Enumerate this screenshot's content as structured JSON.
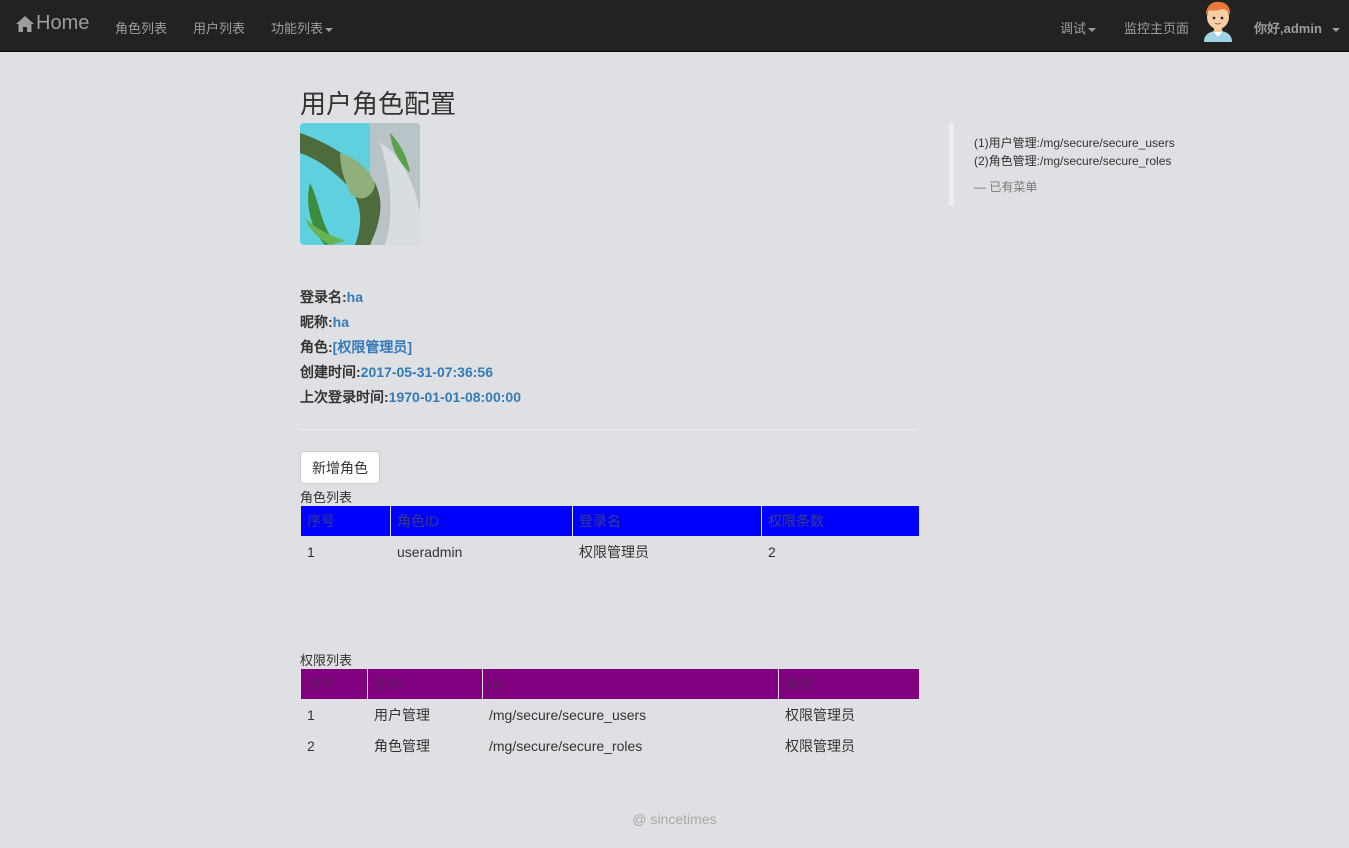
{
  "navbar": {
    "brand": "Home",
    "items": [
      {
        "label": "角色列表"
      },
      {
        "label": "用户列表"
      },
      {
        "label": "功能列表"
      }
    ],
    "right_items": [
      {
        "label": "调试"
      },
      {
        "label": "监控主页面"
      }
    ],
    "user_greeting": "你好,admin"
  },
  "page": {
    "title": "用户角色配置",
    "info": {
      "login_label": "登录名:",
      "login_value": "ha",
      "nickname_label": "昵称:",
      "nickname_value": "ha",
      "role_label": "角色:",
      "role_value": "[权限管理员]",
      "created_label": "创建时间:",
      "created_value": "2017-05-31-07:36:56",
      "lastlogin_label": "上次登录时间:",
      "lastlogin_value": "1970-01-01-08:00:00"
    },
    "add_role_button": "新增角色",
    "roles_caption": "角色列表",
    "roles_table": {
      "headers": [
        "序号",
        "角色ID",
        "登录名",
        "权限条数"
      ],
      "rows": [
        [
          "1",
          "useradmin",
          "权限管理员",
          "2"
        ]
      ]
    },
    "perms_caption": "权限列表",
    "perms_table": {
      "headers": [
        "序号",
        "名称",
        "url",
        "角色"
      ],
      "rows": [
        [
          "1",
          "用户管理",
          "/mg/secure/secure_users",
          "权限管理员"
        ],
        [
          "2",
          "角色管理",
          "/mg/secure/secure_roles",
          "权限管理员"
        ]
      ]
    }
  },
  "sidebar_quote": {
    "lines": [
      "(1)用户管理:/mg/secure/secure_users",
      "(2)角色管理:/mg/secure/secure_roles"
    ],
    "footer": "— 已有菜单"
  },
  "footer": "@ sincetimes",
  "colors": {
    "navbar_bg": "#222222",
    "page_bg": "#dfe0e4",
    "link": "#337ab7",
    "roles_header": "#0000ff",
    "perms_header": "#800080"
  }
}
